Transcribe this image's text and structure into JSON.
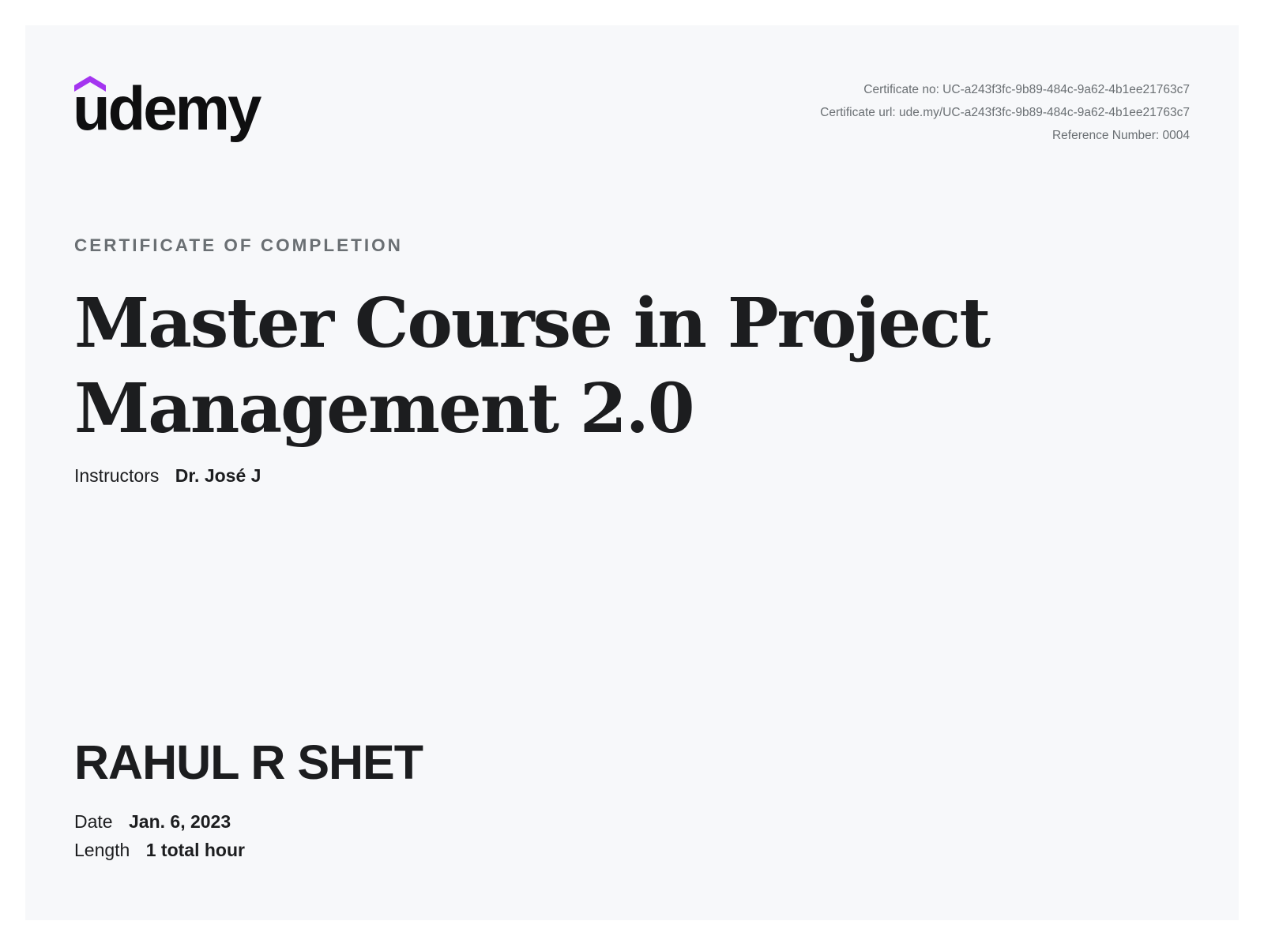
{
  "brand": {
    "logo_text": "udemy",
    "accent_color": "#a435f0",
    "text_color": "#1c1d1f"
  },
  "meta": {
    "certificate_no": "Certificate no: UC-a243f3fc-9b89-484c-9a62-4b1ee21763c7",
    "certificate_url": "Certificate url: ude.my/UC-a243f3fc-9b89-484c-9a62-4b1ee21763c7",
    "reference_number": "Reference Number: 0004"
  },
  "certificate": {
    "eyebrow": "CERTIFICATE OF COMPLETION",
    "course_title": "Master Course in Project Management 2.0",
    "instructors_label": "Instructors",
    "instructors_value": "Dr. José J",
    "recipient_name": "RAHUL R SHET",
    "date_label": "Date",
    "date_value": "Jan. 6, 2023",
    "length_label": "Length",
    "length_value": "1 total hour"
  }
}
